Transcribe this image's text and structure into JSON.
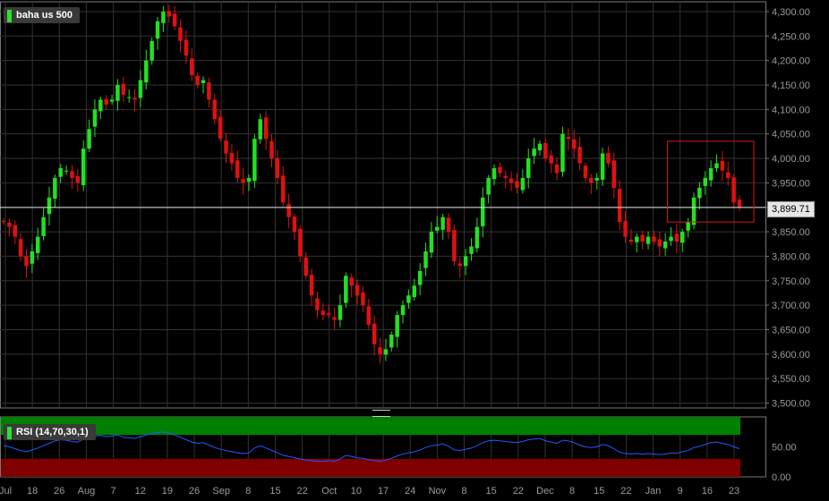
{
  "main_chart": {
    "label": "baha us 500",
    "current_price_label": "3,899.71",
    "current_price": 3899.71,
    "y_ticks": [
      "4,300.00",
      "4,250.00",
      "4,200.00",
      "4,150.00",
      "4,100.00",
      "4,050.00",
      "4,000.00",
      "3,950.00",
      "3,900.00",
      "3,850.00",
      "3,800.00",
      "3,750.00",
      "3,700.00",
      "3,650.00",
      "3,600.00",
      "3,550.00",
      "3,500.00"
    ]
  },
  "rsi_panel": {
    "label": "RSI (14,70,30,1)",
    "y_ticks": [
      "50.00",
      "0.00"
    ]
  },
  "x_ticks": [
    "Jul",
    "18",
    "26",
    "Aug",
    "7",
    "12",
    "19",
    "26",
    "Sep",
    "8",
    "15",
    "22",
    "Oct",
    "10",
    "17",
    "24",
    "Nov",
    "8",
    "15",
    "22",
    "Dec",
    "8",
    "15",
    "22",
    "Jan",
    "9",
    "16",
    "23"
  ],
  "colors": {
    "up": "#22e022",
    "down": "#e01010",
    "grid": "#333333",
    "overbought": "#008000",
    "oversold": "#800000",
    "rsi_line": "#2a55ff"
  },
  "chart_data": {
    "type": "candlestick",
    "title": "",
    "y_axis_range": [
      3490,
      4320
    ],
    "rsi_range": [
      0,
      100
    ],
    "rsi_overbought": 70,
    "rsi_oversold": 30,
    "closes": [
      3870,
      3860,
      3840,
      3800,
      3780,
      3810,
      3840,
      3880,
      3920,
      3960,
      3980,
      3975,
      3960,
      3950,
      4020,
      4060,
      4100,
      4120,
      4110,
      4120,
      4150,
      4130,
      4125,
      4120,
      4160,
      4200,
      4240,
      4280,
      4300,
      4290,
      4270,
      4240,
      4210,
      4170,
      4150,
      4160,
      4120,
      4080,
      4040,
      4010,
      3990,
      3960,
      3950,
      3960,
      4040,
      4080,
      4040,
      4000,
      3960,
      3910,
      3880,
      3850,
      3800,
      3760,
      3720,
      3690,
      3680,
      3680,
      3670,
      3700,
      3760,
      3740,
      3720,
      3700,
      3660,
      3620,
      3600,
      3610,
      3640,
      3680,
      3700,
      3720,
      3740,
      3770,
      3810,
      3850,
      3860,
      3880,
      3850,
      3790,
      3780,
      3800,
      3820,
      3860,
      3920,
      3960,
      3980,
      3970,
      3960,
      3950,
      3940,
      3960,
      4000,
      4020,
      4030,
      4000,
      3990,
      3970,
      4050,
      4040,
      4020,
      3990,
      3960,
      3950,
      3960,
      4010,
      3990,
      3940,
      3870,
      3840,
      3830,
      3840,
      3830,
      3840,
      3830,
      3820,
      3830,
      3840,
      3830,
      3850,
      3870,
      3920,
      3940,
      3960,
      3980,
      3990,
      3975,
      3960,
      3910,
      3899.71
    ],
    "rsi_values": [
      52,
      50,
      47,
      44,
      42,
      45,
      48,
      52,
      56,
      60,
      62,
      61,
      59,
      58,
      63,
      66,
      68,
      69,
      67,
      68,
      70,
      66,
      65,
      64,
      67,
      70,
      72,
      74,
      75,
      73,
      70,
      66,
      62,
      58,
      56,
      57,
      53,
      49,
      46,
      44,
      42,
      40,
      39,
      40,
      48,
      52,
      48,
      44,
      40,
      36,
      34,
      32,
      30,
      28,
      27,
      26,
      26,
      27,
      26,
      30,
      36,
      34,
      32,
      31,
      29,
      27,
      26,
      28,
      31,
      35,
      38,
      40,
      42,
      45,
      49,
      52,
      53,
      55,
      51,
      45,
      44,
      46,
      48,
      52,
      57,
      60,
      61,
      60,
      59,
      58,
      57,
      59,
      62,
      63,
      64,
      60,
      58,
      56,
      61,
      60,
      57,
      53,
      50,
      49,
      50,
      54,
      52,
      47,
      41,
      39,
      38,
      39,
      38,
      39,
      38,
      37,
      38,
      40,
      39,
      42,
      44,
      49,
      51,
      54,
      57,
      58,
      56,
      54,
      50,
      47
    ]
  }
}
